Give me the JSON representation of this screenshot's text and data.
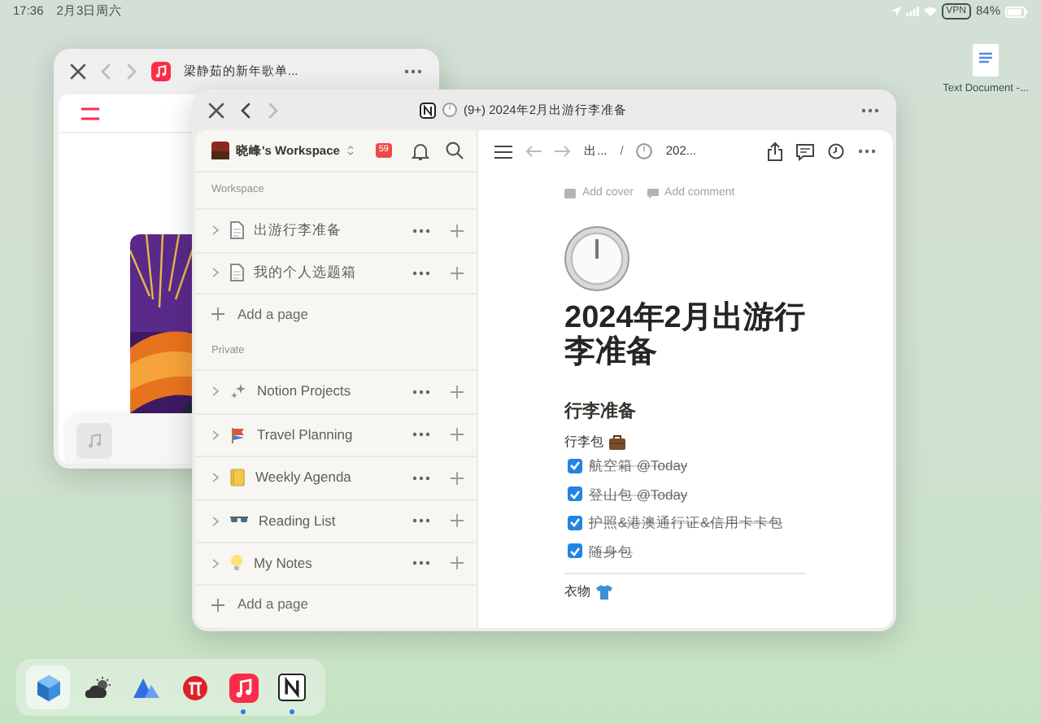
{
  "status_bar": {
    "time": "17:36",
    "date": "2月3日周六",
    "vpn": "VPN",
    "battery": "84%"
  },
  "desktop_files": [
    {
      "label": "Text Document -..."
    }
  ],
  "music_window": {
    "title": "梁静茹的新年歌单...",
    "back_enabled": false,
    "forward_enabled": false
  },
  "notion_window": {
    "title": "(9+) 2024年2月出游行李准备",
    "back_enabled": true,
    "forward_enabled": false,
    "sidebar": {
      "workspace": "晓峰's Workspace",
      "badge": "59",
      "sections": [
        {
          "heading": "Workspace",
          "add_label": "Add a page",
          "items": [
            {
              "label": "出游行李准备",
              "kind": "document"
            },
            {
              "label": "我的个人选题箱",
              "kind": "document"
            }
          ]
        },
        {
          "heading": "Private",
          "add_label": "Add a page",
          "items": [
            {
              "label": "Notion Projects",
              "kind": "sparkles"
            },
            {
              "label": "Travel Planning",
              "kind": "flag"
            },
            {
              "label": "Weekly Agenda",
              "kind": "notebook"
            },
            {
              "label": "Reading List",
              "kind": "glasses"
            },
            {
              "label": "My Notes",
              "kind": "bulb"
            }
          ]
        }
      ]
    },
    "toolbar": {
      "back_enabled": false,
      "forward_enabled": false,
      "breadcrumbs": [
        "出...",
        "202..."
      ],
      "separator": "/"
    },
    "page": {
      "add_cover": "Add cover",
      "add_comment": "Add comment",
      "title": "2024年2月出游行李准备",
      "heading": "行李准备",
      "groups": [
        {
          "label": "行李包",
          "kind": "briefcase",
          "items": [
            {
              "text": "航空箱",
              "mention": "@Today",
              "checked": true
            },
            {
              "text": "登山包",
              "mention": "@Today",
              "checked": true
            },
            {
              "text": "护照&港澳通行证&信用卡卡包",
              "checked": true
            },
            {
              "text": "随身包",
              "checked": true
            }
          ]
        },
        {
          "label": "衣物",
          "kind": "shirt"
        }
      ]
    }
  },
  "dock": [
    {
      "kind": "cube",
      "selected": true,
      "running": false
    },
    {
      "kind": "weather",
      "selected": false,
      "running": false
    },
    {
      "kind": "triangle",
      "selected": false,
      "running": false
    },
    {
      "kind": "pi",
      "selected": false,
      "running": false
    },
    {
      "kind": "music",
      "selected": false,
      "running": true
    },
    {
      "kind": "notion",
      "selected": false,
      "running": true
    }
  ]
}
